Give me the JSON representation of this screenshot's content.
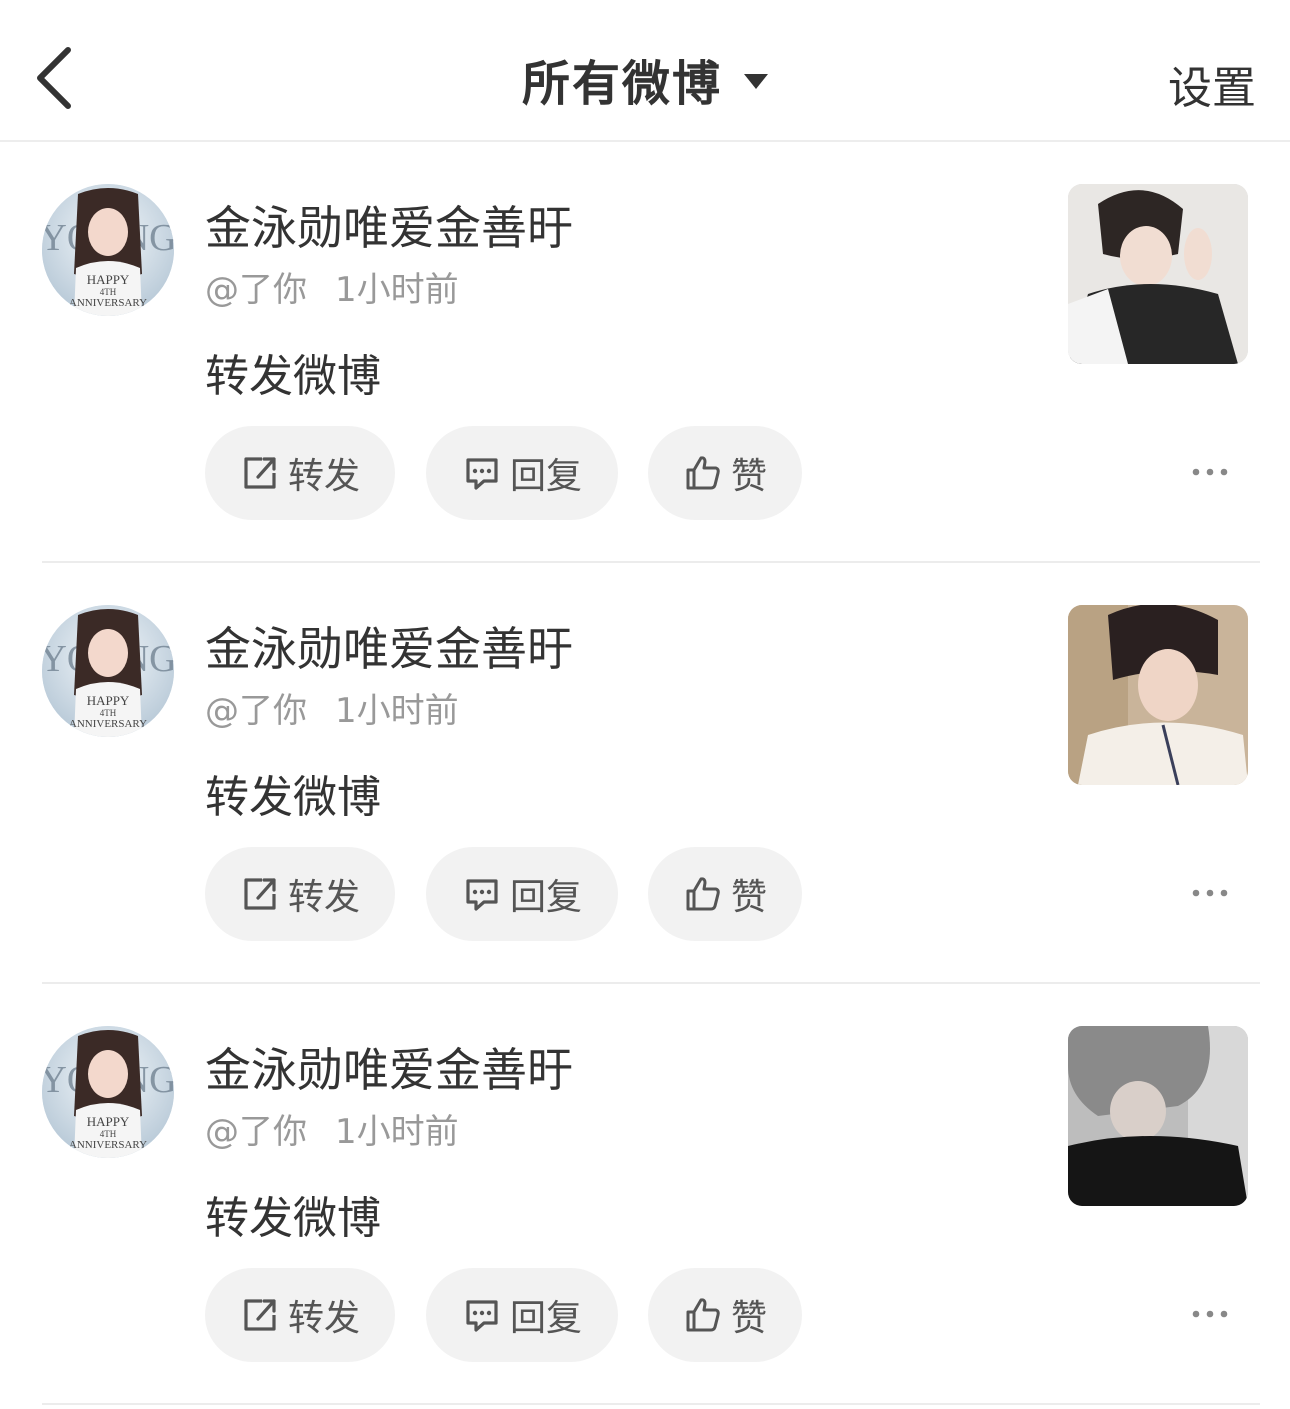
{
  "header": {
    "title": "所有微博",
    "settings_label": "设置"
  },
  "posts": [
    {
      "username": "金泳勋唯爱金善旴",
      "handle": "@了你",
      "time": "1小时前",
      "content": "转发微博",
      "repost_label": "转发",
      "reply_label": "回复",
      "like_label": "赞"
    },
    {
      "username": "金泳勋唯爱金善旴",
      "handle": "@了你",
      "time": "1小时前",
      "content": "转发微博",
      "repost_label": "转发",
      "reply_label": "回复",
      "like_label": "赞"
    },
    {
      "username": "金泳勋唯爱金善旴",
      "handle": "@了你",
      "time": "1小时前",
      "content": "转发微博",
      "repost_label": "转发",
      "reply_label": "回复",
      "like_label": "赞"
    }
  ],
  "avatar_text": {
    "line1": "YOUNG",
    "line2": "HAPPY",
    "line3": "4TH",
    "line4": "ANNIVERSARY"
  },
  "icons": [
    "back-arrow-icon",
    "dropdown-caret-icon",
    "share-icon",
    "comment-icon",
    "thumbs-up-icon",
    "more-dots-icon"
  ]
}
